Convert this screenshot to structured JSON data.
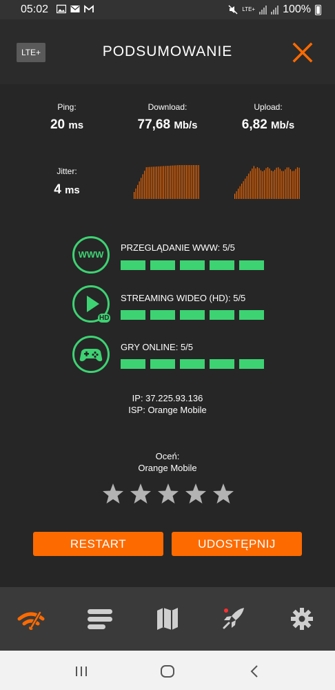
{
  "status_bar": {
    "time": "05:02",
    "network": "LTE+",
    "battery": "100%"
  },
  "header": {
    "network_badge": "LTE+",
    "title": "PODSUMOWANIE"
  },
  "results": {
    "ping_label": "Ping:",
    "ping_value": "20",
    "ping_unit": "ms",
    "download_label": "Download:",
    "download_value": "77,68",
    "download_unit": "Mb/s",
    "upload_label": "Upload:",
    "upload_value": "6,82",
    "upload_unit": "Mb/s",
    "jitter_label": "Jitter:",
    "jitter_value": "4",
    "jitter_unit": "ms"
  },
  "categories": [
    {
      "icon_text": "WWW",
      "label": "PRZEGLĄDANIE WWW: 5/5",
      "score": 5,
      "max": 5
    },
    {
      "icon_badge": "HD",
      "label": "STREAMING WIDEO (HD): 5/5",
      "score": 5,
      "max": 5
    },
    {
      "label": "GRY ONLINE: 5/5",
      "score": 5,
      "max": 5
    }
  ],
  "connection": {
    "ip": "IP: 37.225.93.136",
    "isp": "ISP: Orange Mobile"
  },
  "rating": {
    "prompt": "Oceń:",
    "provider": "Orange Mobile",
    "stars_filled": 0,
    "stars_total": 5
  },
  "buttons": {
    "restart": "RESTART",
    "share": "UDOSTĘPNIJ"
  },
  "nav": {
    "items": [
      "speed-test-icon",
      "results-list-icon",
      "map-icon",
      "rocket-icon",
      "settings-icon"
    ],
    "active": "speed-test-icon"
  },
  "colors": {
    "accent_orange": "#fd6a00",
    "score_green": "#3dd373",
    "background": "#262626"
  }
}
